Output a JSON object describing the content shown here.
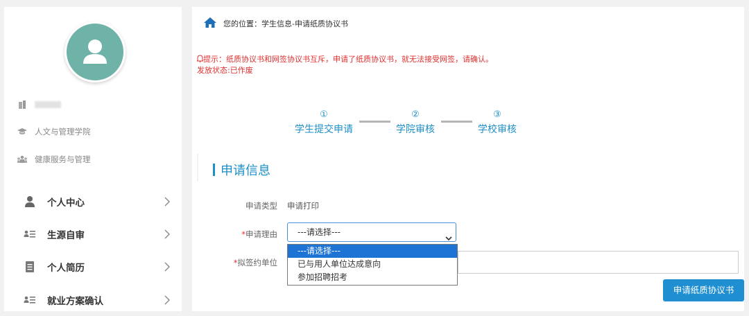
{
  "sidebar": {
    "info": {
      "college": "人文与管理学院",
      "major": "健康服务与管理"
    },
    "menu": [
      {
        "label": "个人中心",
        "icon": "user-icon"
      },
      {
        "label": "生源自审",
        "icon": "id-card-icon"
      },
      {
        "label": "个人简历",
        "icon": "document-icon"
      },
      {
        "label": "就业方案确认",
        "icon": "id-card-icon"
      }
    ]
  },
  "breadcrumb": {
    "text": "您的位置：学生信息-申请纸质协议书"
  },
  "notice": {
    "tip": "提示：纸质协议书和网签协议书互斥，申请了纸质协议书，就无法接受网签，请确认。",
    "status": "发放状态:已作废"
  },
  "steps": [
    {
      "num": "①",
      "label": "学生提交申请"
    },
    {
      "num": "②",
      "label": "学院审核"
    },
    {
      "num": "③",
      "label": "学校审核"
    }
  ],
  "section": {
    "title": "申请信息"
  },
  "form": {
    "type_label": "申请类型",
    "type_value": "申请打印",
    "reason_required": "*",
    "reason_label": "申请理由",
    "reason_selected": "---请选择---",
    "reason_options": [
      "---请选择---",
      "已与用人单位达成意向",
      "参加招聘招考"
    ],
    "unit_required": "*",
    "unit_label": "拟签约单位",
    "unit_value": ""
  },
  "actions": {
    "submit_label": "申请纸质协议书"
  },
  "colors": {
    "accent": "#1e8fc7",
    "avatar_bg": "#6fb3a8",
    "warning": "#e03030",
    "selected_option": "#1e74d4"
  }
}
